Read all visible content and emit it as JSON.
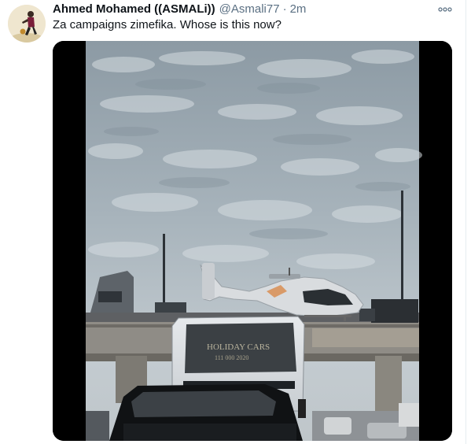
{
  "tweet": {
    "author_name": "Ahmed Mohamed ((ASMALi))",
    "author_handle": "@Asmali77",
    "separator": "·",
    "timestamp": "2m",
    "text": "Za campaigns zimefika. Whose is this now?",
    "more_icon": "more-options-icon",
    "avatar_icon": "profile-photo"
  },
  "media": {
    "type": "video",
    "bus_sign": "HOLIDAY CARS",
    "bus_sign_line2": "111 000 2020"
  },
  "colors": {
    "name": "#0f1419",
    "secondary": "#5b7083",
    "border": "#e6ecf0"
  }
}
